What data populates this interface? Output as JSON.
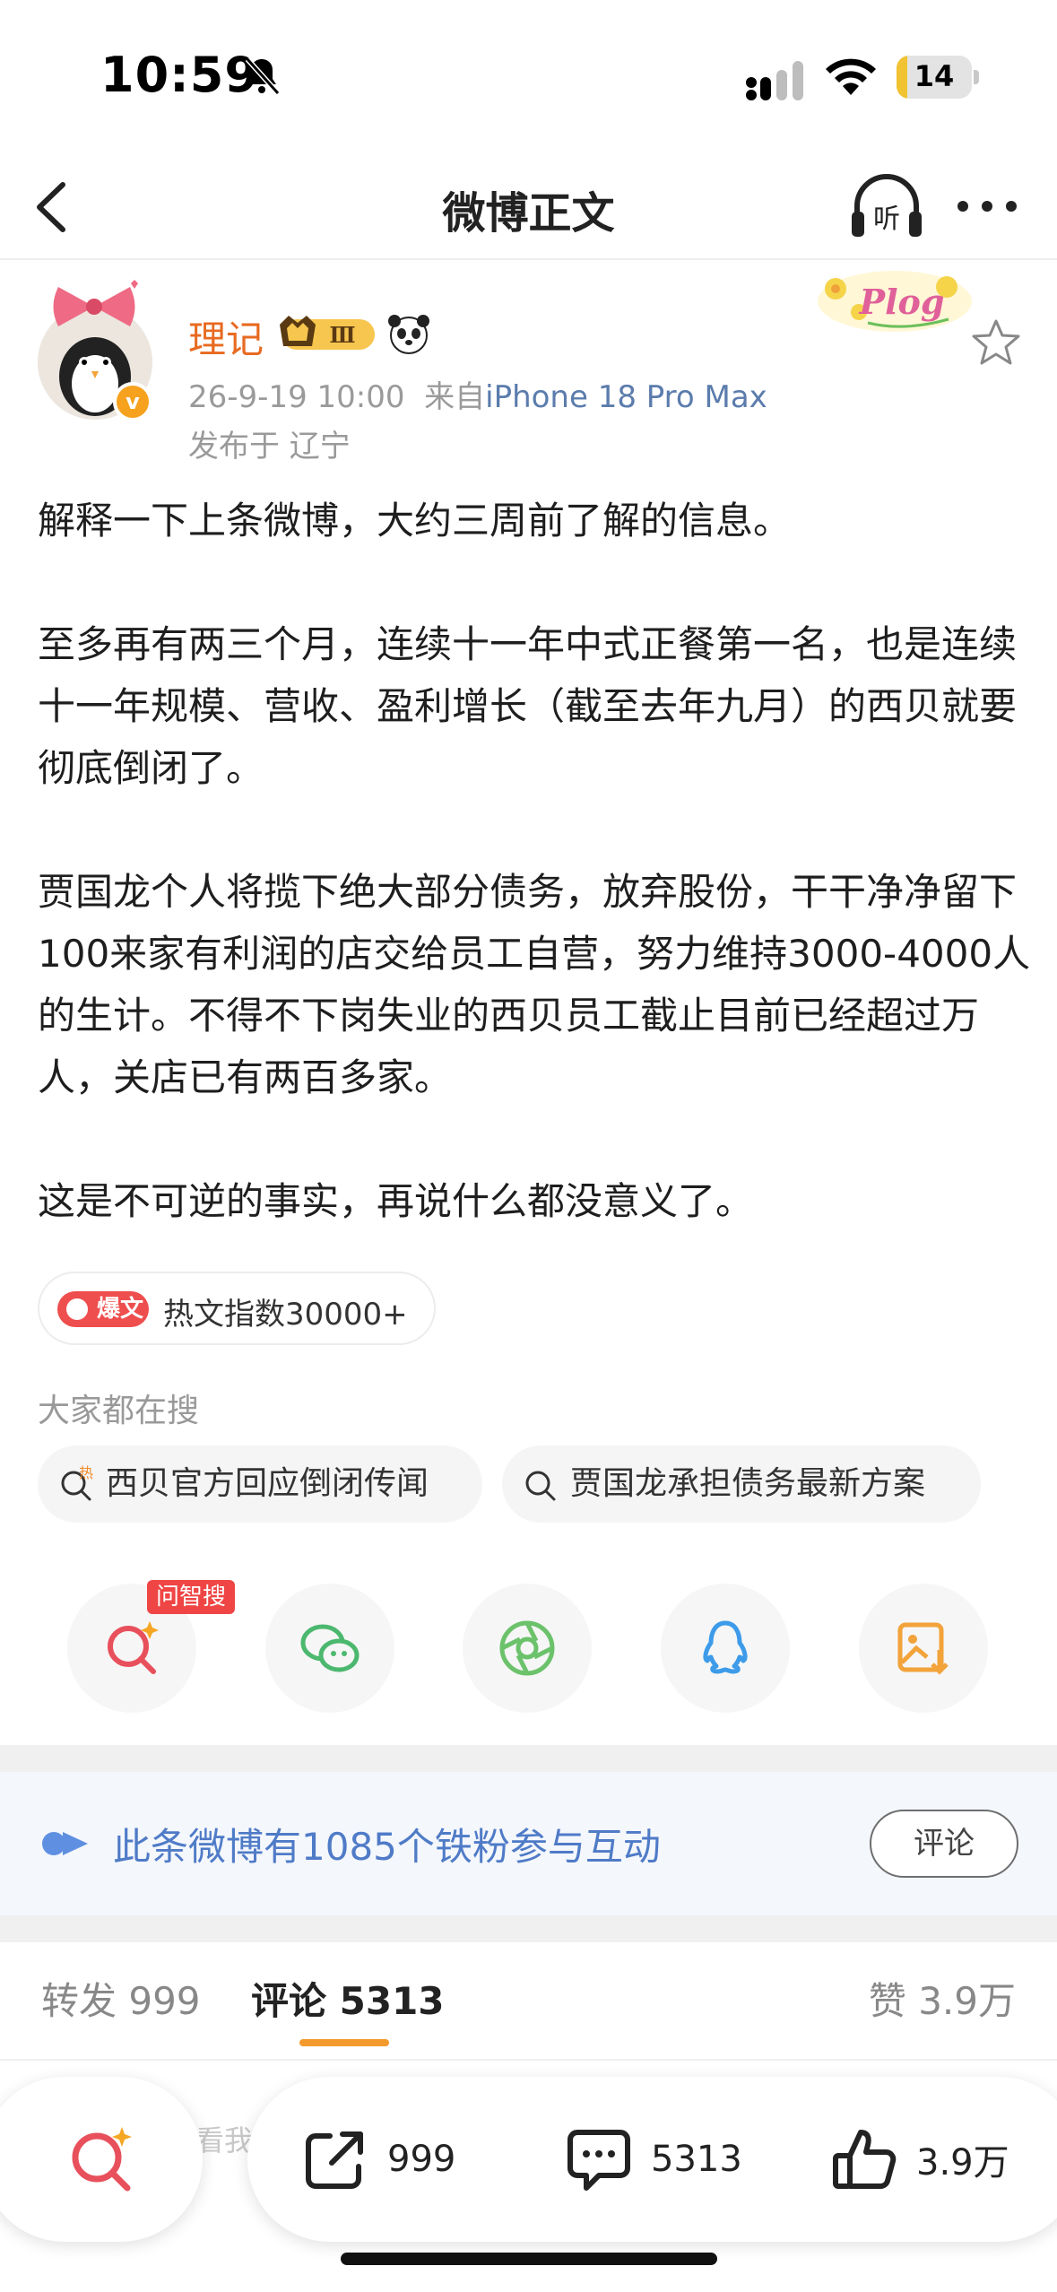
{
  "status_bar": {
    "time": "10:59",
    "battery": "14",
    "battery_percent": 14
  },
  "nav": {
    "title": "微博正文",
    "listen_label": "听"
  },
  "author": {
    "name": "理记",
    "vip_level": "Ⅲ",
    "verified_mark": "v",
    "timestamp": "26-9-19 10:00",
    "from_label": "来自",
    "device": "iPhone 18 Pro Max",
    "location": "发布于 辽宁",
    "plog_label": "Plog"
  },
  "post": {
    "paragraphs": [
      "解释一下上条微博，大约三周前了解的信息。",
      "至多再有两三个月，连续十一年中式正餐第一名，也是连续十一年规模、营收、盈利增长（截至去年九月）的西贝就要彻底倒闭了。",
      "贾国龙个人将揽下绝大部分债务，放弃股份，干干净净留下100来家有利润的店交给员工自营，努力维持3000-4000人的生计。不得不下岗失业的西贝员工截止目前已经超过万人，关店已有两百多家。",
      "这是不可逆的事实，再说什么都没意义了。"
    ]
  },
  "hot_tag": {
    "badge": "爆文",
    "text": "热文指数30000+"
  },
  "search": {
    "heading": "大家都在搜",
    "chips": [
      {
        "text": "西贝官方回应倒闭传闻",
        "badge": "热"
      },
      {
        "text": "贾国龙承担债务最新方案"
      }
    ]
  },
  "share": {
    "ai_label": "问智搜"
  },
  "fans": {
    "text": "此条微博有1085个铁粉参与互动",
    "button": "评论"
  },
  "tabs": {
    "repost": "转发 999",
    "comment": "评论 5313",
    "like": "赞 3.9万"
  },
  "bottom": {
    "placeholder": "看我",
    "repost_count": "999",
    "comment_count": "5313",
    "like_count": "3.9万"
  },
  "colors": {
    "accent": "#f29a2c",
    "author_name": "#e86a21",
    "link_blue": "#4f7bc7",
    "hot_red": "#ef4e4e"
  }
}
